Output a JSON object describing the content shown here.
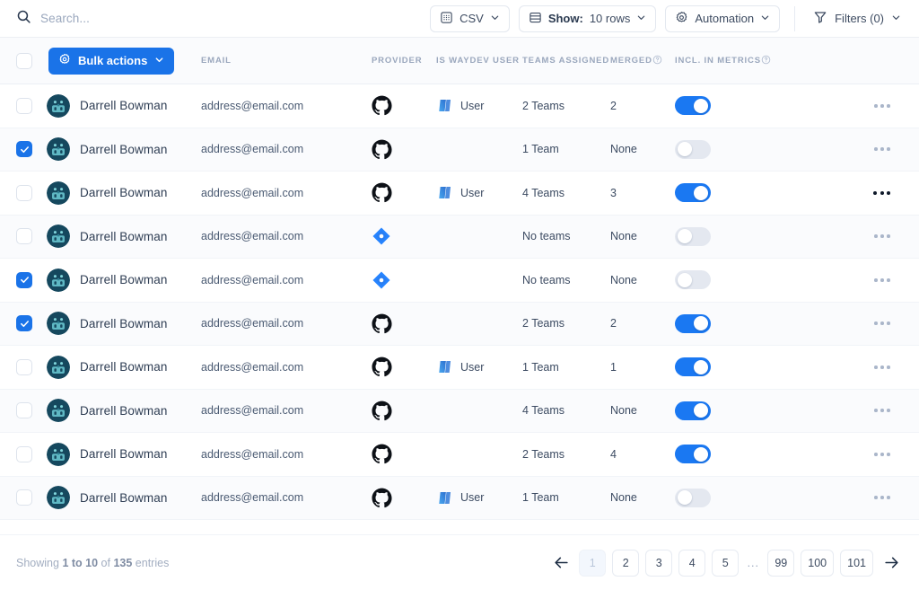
{
  "toolbar": {
    "search_placeholder": "Search...",
    "search_value": "",
    "csv_label": "CSV",
    "show_label_strong": "Show:",
    "show_label_value": "10 rows",
    "automation_label": "Automation",
    "filters_label": "Filters (0)"
  },
  "table": {
    "bulk_actions_label": "Bulk actions",
    "headers": {
      "email": "EMAIL",
      "provider": "PROVIDER",
      "is_waydev_user": "IS WAYDEV USER",
      "teams_assigned": "TEAMS ASSIGNED",
      "merged": "MERGED",
      "incl_in_metrics": "INCL. IN METRICS"
    },
    "rows": [
      {
        "selected": false,
        "name": "Darrell Bowman",
        "email": "address@email.com",
        "provider": "github-icon",
        "waydev_user": "User",
        "teams": "2 Teams",
        "merged": "2",
        "included": true,
        "kebab_active": false
      },
      {
        "selected": true,
        "name": "Darrell Bowman",
        "email": "address@email.com",
        "provider": "github-icon",
        "waydev_user": "",
        "teams": "1 Team",
        "merged": "None",
        "included": false,
        "kebab_active": false
      },
      {
        "selected": false,
        "name": "Darrell Bowman",
        "email": "address@email.com",
        "provider": "github-icon",
        "waydev_user": "User",
        "teams": "4 Teams",
        "merged": "3",
        "included": true,
        "kebab_active": true
      },
      {
        "selected": false,
        "name": "Darrell Bowman",
        "email": "address@email.com",
        "provider": "jira-icon",
        "waydev_user": "",
        "teams": "No teams",
        "merged": "None",
        "included": false,
        "kebab_active": false
      },
      {
        "selected": true,
        "name": "Darrell Bowman",
        "email": "address@email.com",
        "provider": "jira-icon",
        "waydev_user": "",
        "teams": "No teams",
        "merged": "None",
        "included": false,
        "kebab_active": false
      },
      {
        "selected": true,
        "name": "Darrell Bowman",
        "email": "address@email.com",
        "provider": "github-icon",
        "waydev_user": "",
        "teams": "2 Teams",
        "merged": "2",
        "included": true,
        "kebab_active": false
      },
      {
        "selected": false,
        "name": "Darrell Bowman",
        "email": "address@email.com",
        "provider": "github-icon",
        "waydev_user": "User",
        "teams": "1 Team",
        "merged": "1",
        "included": true,
        "kebab_active": false
      },
      {
        "selected": false,
        "name": "Darrell Bowman",
        "email": "address@email.com",
        "provider": "github-icon",
        "waydev_user": "",
        "teams": "4 Teams",
        "merged": "None",
        "included": true,
        "kebab_active": false
      },
      {
        "selected": false,
        "name": "Darrell Bowman",
        "email": "address@email.com",
        "provider": "github-icon",
        "waydev_user": "",
        "teams": "2 Teams",
        "merged": "4",
        "included": true,
        "kebab_active": false
      },
      {
        "selected": false,
        "name": "Darrell Bowman",
        "email": "address@email.com",
        "provider": "github-icon",
        "waydev_user": "User",
        "teams": "1 Team",
        "merged": "None",
        "included": false,
        "kebab_active": false
      }
    ]
  },
  "footer": {
    "showing_prefix": "Showing",
    "showing_range": "1 to 10",
    "showing_of": "of",
    "showing_total": "135",
    "showing_suffix": "entries",
    "pages": [
      "1",
      "2",
      "3",
      "4",
      "5",
      "...",
      "99",
      "100",
      "101"
    ],
    "active_page": "1"
  },
  "colors": {
    "accent": "#1a73e8",
    "toggle_on": "#1a78f2",
    "toggle_off": "#e4e8f0",
    "header_text": "#9aa7bd",
    "row_alt": "#fafbfd",
    "avatar_bg": "#15485e"
  }
}
